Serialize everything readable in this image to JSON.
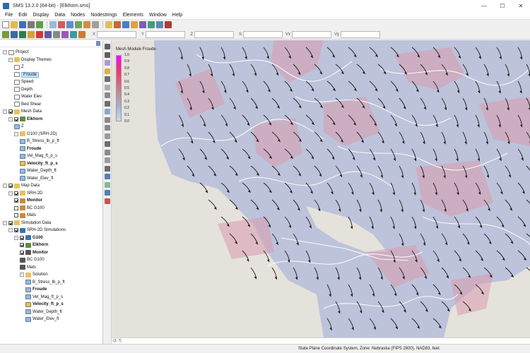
{
  "window": {
    "title": "SMS 13.2.0 (64-bit) - [Elkhorn.sms]",
    "buttons": [
      "—",
      "☐",
      "✕"
    ]
  },
  "menu": [
    "File",
    "Edit",
    "Display",
    "Data",
    "Nodes",
    "Nodestrings",
    "Elements",
    "Window",
    "Help"
  ],
  "coordinate_fields": {
    "labels": [
      "X",
      "Y",
      "Z",
      "S",
      "Vx",
      "Vy"
    ],
    "values": [
      "",
      "",
      "",
      "",
      "",
      ""
    ]
  },
  "project_tree": {
    "items": [
      {
        "label": "Project",
        "depth": 0,
        "toggle": "−",
        "check": null,
        "icon": "doc",
        "bold": false,
        "selected": false
      },
      {
        "label": "Display Themes",
        "depth": 1,
        "toggle": "−",
        "check": null,
        "icon": "folder",
        "bold": false,
        "selected": false
      },
      {
        "label": "Z",
        "depth": 2,
        "toggle": null,
        "check": null,
        "icon": "doc",
        "bold": false,
        "selected": false
      },
      {
        "label": "Froude",
        "depth": 2,
        "toggle": null,
        "check": null,
        "icon": "doc",
        "bold": false,
        "selected": true
      },
      {
        "label": "Speed",
        "depth": 2,
        "toggle": null,
        "check": null,
        "icon": "doc",
        "bold": false,
        "selected": false
      },
      {
        "label": "Depth",
        "depth": 2,
        "toggle": null,
        "check": null,
        "icon": "doc",
        "bold": false,
        "selected": false
      },
      {
        "label": "Water Elev",
        "depth": 2,
        "toggle": null,
        "check": null,
        "icon": "doc",
        "bold": false,
        "selected": false
      },
      {
        "label": "Bed Shear",
        "depth": 2,
        "toggle": null,
        "check": null,
        "icon": "doc",
        "bold": false,
        "selected": false
      },
      {
        "label": "Mesh Data",
        "depth": 0,
        "toggle": "−",
        "check": true,
        "icon": "folder",
        "bold": false,
        "selected": false
      },
      {
        "label": "Elkhorn",
        "depth": 1,
        "toggle": "−",
        "check": true,
        "icon": "mesh",
        "bold": true,
        "selected": false
      },
      {
        "label": "Z",
        "depth": 2,
        "toggle": null,
        "check": null,
        "icon": "data",
        "bold": false,
        "selected": false
      },
      {
        "label": "G100 (SRH-2D)",
        "depth": 2,
        "toggle": "−",
        "check": null,
        "icon": "folder",
        "bold": false,
        "selected": false
      },
      {
        "label": "B_Stress_lb_p_ft",
        "depth": 3,
        "toggle": null,
        "check": null,
        "icon": "data",
        "bold": false,
        "selected": false
      },
      {
        "label": "Froude",
        "depth": 3,
        "toggle": null,
        "check": null,
        "icon": "data",
        "bold": true,
        "selected": false
      },
      {
        "label": "Vel_Mag_ft_p_s",
        "depth": 3,
        "toggle": null,
        "check": null,
        "icon": "data",
        "bold": false,
        "selected": false
      },
      {
        "label": "Velocity_ft_p_s",
        "depth": 3,
        "toggle": null,
        "check": null,
        "icon": "vec",
        "bold": true,
        "selected": false
      },
      {
        "label": "Water_Depth_ft",
        "depth": 3,
        "toggle": null,
        "check": null,
        "icon": "data",
        "bold": false,
        "selected": false
      },
      {
        "label": "Water_Elev_ft",
        "depth": 3,
        "toggle": null,
        "check": null,
        "icon": "data",
        "bold": false,
        "selected": false
      },
      {
        "label": "Map Data",
        "depth": 0,
        "toggle": "−",
        "check": true,
        "icon": "folder",
        "bold": false,
        "selected": false
      },
      {
        "label": "SRH-2D",
        "depth": 1,
        "toggle": "−",
        "check": true,
        "icon": "folder",
        "bold": false,
        "selected": false
      },
      {
        "label": "Monitor",
        "depth": 2,
        "toggle": null,
        "check": true,
        "icon": "map",
        "bold": true,
        "selected": false
      },
      {
        "label": "BC G100",
        "depth": 2,
        "toggle": null,
        "check": false,
        "icon": "map",
        "bold": false,
        "selected": false
      },
      {
        "label": "Mats",
        "depth": 2,
        "toggle": null,
        "check": false,
        "icon": "map",
        "bold": false,
        "selected": false
      },
      {
        "label": "Simulation Data",
        "depth": 0,
        "toggle": "−",
        "check": true,
        "icon": "folder",
        "bold": false,
        "selected": false
      },
      {
        "label": "SRH-2D Simulations",
        "depth": 1,
        "toggle": "−",
        "check": true,
        "icon": "sim",
        "bold": false,
        "selected": false
      },
      {
        "label": "G100",
        "depth": 2,
        "toggle": "−",
        "check": true,
        "icon": "sim",
        "bold": true,
        "selected": false
      },
      {
        "label": "Elkhorn",
        "depth": 3,
        "toggle": null,
        "check": true,
        "icon": "mesh",
        "bold": true,
        "selected": false
      },
      {
        "label": "Monitor",
        "depth": 3,
        "toggle": null,
        "check": true,
        "icon": "cov",
        "bold": true,
        "selected": false
      },
      {
        "label": "BC G100",
        "depth": 3,
        "toggle": null,
        "check": null,
        "icon": "cov",
        "bold": false,
        "selected": false
      },
      {
        "label": "Mats",
        "depth": 3,
        "toggle": null,
        "check": null,
        "icon": "cov",
        "bold": false,
        "selected": false
      },
      {
        "label": "Solution",
        "depth": 3,
        "toggle": "−",
        "check": null,
        "icon": "folder",
        "bold": false,
        "selected": false
      },
      {
        "label": "B_Stress_lb_p_ft",
        "depth": 4,
        "toggle": null,
        "check": null,
        "icon": "data",
        "bold": false,
        "selected": false
      },
      {
        "label": "Froude",
        "depth": 4,
        "toggle": null,
        "check": null,
        "icon": "data",
        "bold": true,
        "selected": false
      },
      {
        "label": "Vel_Mag_ft_p_s",
        "depth": 4,
        "toggle": null,
        "check": null,
        "icon": "data",
        "bold": false,
        "selected": false
      },
      {
        "label": "Velocity_ft_p_s",
        "depth": 4,
        "toggle": null,
        "check": null,
        "icon": "vec",
        "bold": true,
        "selected": false
      },
      {
        "label": "Water_Depth_ft",
        "depth": 4,
        "toggle": null,
        "check": null,
        "icon": "data",
        "bold": false,
        "selected": false
      },
      {
        "label": "Water_Elev_ft",
        "depth": 4,
        "toggle": null,
        "check": null,
        "icon": "data",
        "bold": false,
        "selected": false
      }
    ]
  },
  "legend": {
    "title": "Mesh Module Froude",
    "values": [
      "1.0",
      "0.9",
      "0.8",
      "0.7",
      "0.6",
      "0.5",
      "0.4",
      "0.3",
      "0.2",
      "0.1",
      "0.0"
    ]
  },
  "cursor_readout": "(3, ?)",
  "status": "State Plane Coordinate System, Zone: Nebraska (FIPS 2600), NAD83, feet",
  "colors": {
    "mesh_fill": "#b9c1d9",
    "high_froude": "#d99aae",
    "vectors": "#1a1a1a",
    "contours": "#ffffff",
    "background_map": "#e5e2dc"
  }
}
